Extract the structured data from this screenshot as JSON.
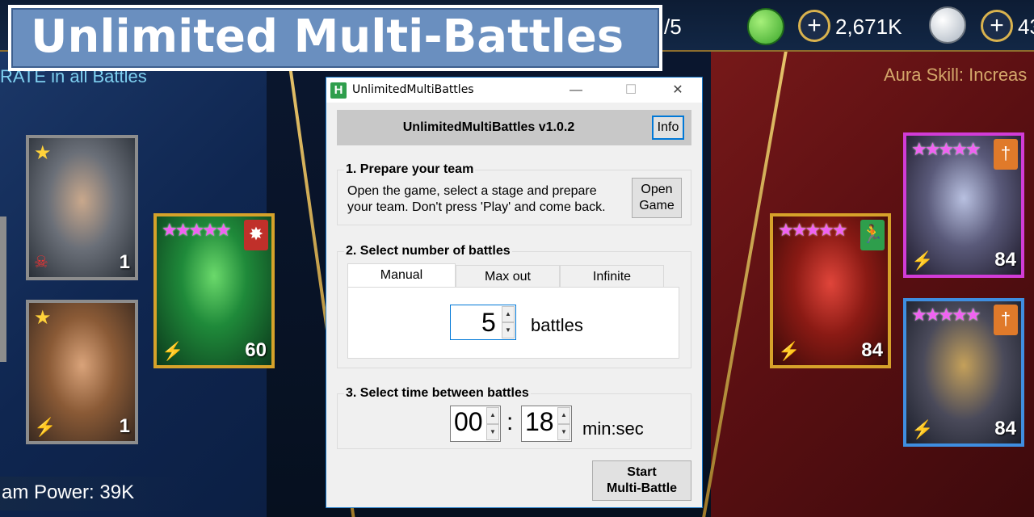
{
  "banner": {
    "title": "Unlimited Multi-Battles"
  },
  "game": {
    "topbar": {
      "energy_suffix": "/5",
      "silver": "2,671K",
      "gems_partial": "43"
    },
    "aura_left": "RATE in all Battles",
    "aura_right": "Aura Skill: Increas",
    "team_power": "am Power: 39K",
    "left_heroes": [
      {
        "level": "1"
      },
      {
        "level": "1"
      },
      {
        "level": "60"
      }
    ],
    "right_heroes": [
      {
        "level": "84"
      },
      {
        "level": "84"
      },
      {
        "level": "84"
      }
    ]
  },
  "window": {
    "title": "UnlimitedMultiBattles",
    "app_icon_letter": "H",
    "header": "UnlimitedMultiBattles v1.0.2",
    "info_button": "Info",
    "step1": {
      "label": "1. Prepare your team",
      "line1": "Open the game, select a stage and prepare",
      "line2": "your team. Don't press 'Play' and come back.",
      "open_line1": "Open",
      "open_line2": "Game"
    },
    "step2": {
      "label": "2. Select number of battles",
      "tabs": [
        "Manual",
        "Max out",
        "Infinite"
      ],
      "value": "5",
      "unit": "battles"
    },
    "step3": {
      "label": "3. Select time between battles",
      "minutes": "00",
      "separator": ":",
      "seconds": "18",
      "unit": "min:sec"
    },
    "start_line1": "Start",
    "start_line2": "Multi-Battle"
  }
}
